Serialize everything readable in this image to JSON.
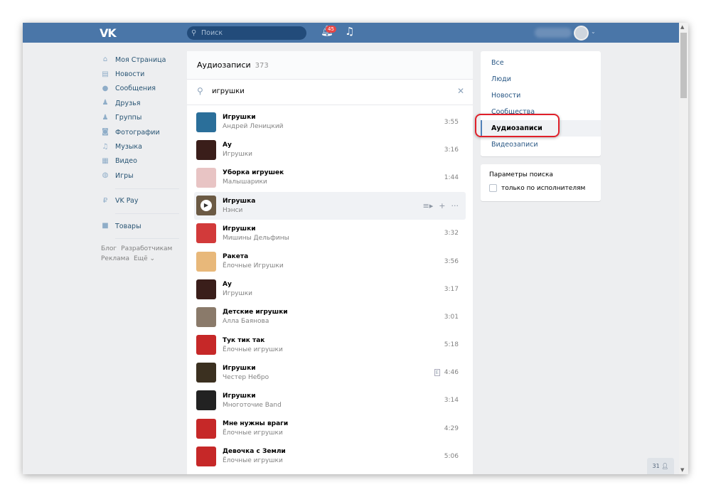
{
  "header": {
    "logo": "VK",
    "search_placeholder": "Поиск",
    "notifications": "45"
  },
  "nav": {
    "items": [
      {
        "label": "Моя Страница",
        "icon": "⌂"
      },
      {
        "label": "Новости",
        "icon": "▤"
      },
      {
        "label": "Сообщения",
        "icon": "●"
      },
      {
        "label": "Друзья",
        "icon": "♟"
      },
      {
        "label": "Группы",
        "icon": "♟"
      },
      {
        "label": "Фотографии",
        "icon": "◙"
      },
      {
        "label": "Музыка",
        "icon": "♫"
      },
      {
        "label": "Видео",
        "icon": "▦"
      },
      {
        "label": "Игры",
        "icon": "◍"
      }
    ],
    "vkpay": "VK Pay",
    "goods": "Товары",
    "footer": [
      "Блог",
      "Разработчикам",
      "Реклама",
      "Ещё ⌄"
    ]
  },
  "main": {
    "title": "Аудиозаписи",
    "count": "373",
    "query": "игрушки",
    "tracks": [
      {
        "title": "Игрушки",
        "artist": "Андрей Леницкий",
        "duration": "3:55",
        "color": "#2b6f9a"
      },
      {
        "title": "Ау",
        "artist": "Игрушки",
        "duration": "3:16",
        "color": "#3a1e1a"
      },
      {
        "title": "Уборка игрушек",
        "artist": "Малышарики",
        "duration": "1:44",
        "color": "#e8c4c4"
      },
      {
        "title": "Игрушка",
        "artist": "Нэнси",
        "duration": "",
        "color": "#6b5a44"
      },
      {
        "title": "Игрушки",
        "artist": "Мишины Дельфины",
        "duration": "3:32",
        "color": "#d23a3a"
      },
      {
        "title": "Ракета",
        "artist": "Ёлочные Игрушки",
        "duration": "3:56",
        "color": "#e8b87a"
      },
      {
        "title": "Ау",
        "artist": "Игрушки",
        "duration": "3:17",
        "color": "#3a1e1a"
      },
      {
        "title": "Детские игрушки",
        "artist": "Алла Баянова",
        "duration": "3:01",
        "color": "#8a7a6a"
      },
      {
        "title": "Тук тик так",
        "artist": "Ёлочные игрушки",
        "duration": "5:18",
        "color": "#c62828"
      },
      {
        "title": "Игрушки",
        "artist": "Честер Небро",
        "duration": "4:46",
        "color": "#3b3020",
        "explicit": "E"
      },
      {
        "title": "Игрушки",
        "artist": "Многоточие Band",
        "duration": "3:14",
        "color": "#222"
      },
      {
        "title": "Мне нужны враги",
        "artist": "Ёлочные игрушки",
        "duration": "4:29",
        "color": "#c62828"
      },
      {
        "title": "Девочка с Земли",
        "artist": "Ёлочные игрушки",
        "duration": "5:06",
        "color": "#c62828"
      }
    ]
  },
  "filters": {
    "items": [
      "Все",
      "Люди",
      "Новости",
      "Сообщества",
      "Аудиозаписи",
      "Видеозаписи"
    ],
    "selected": 4,
    "params_title": "Параметры поиска",
    "only_artists": "только по исполнителям"
  },
  "chat_count": "31"
}
